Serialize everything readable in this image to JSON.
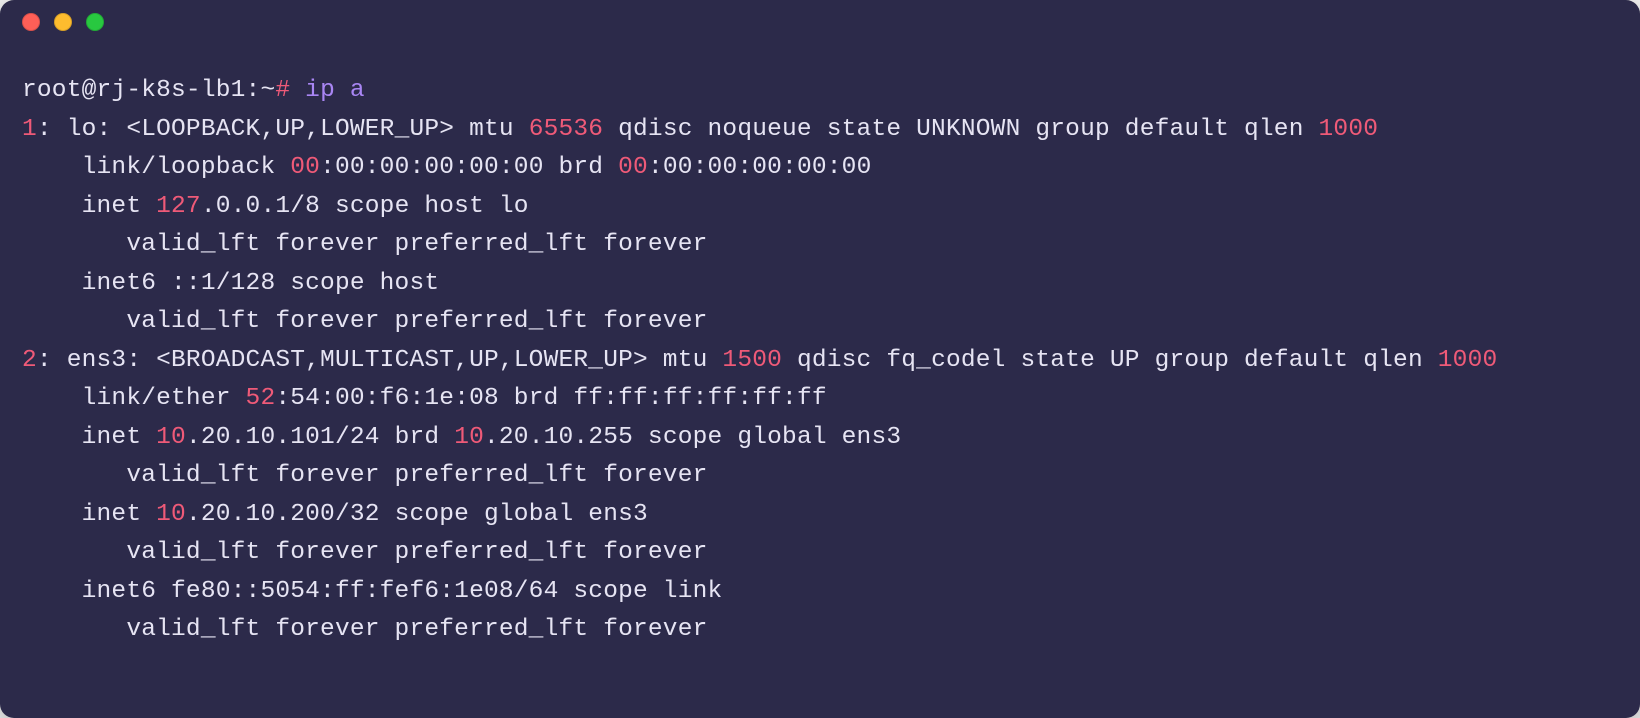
{
  "prompt": {
    "user_host": "root@rj-k8s-lb1",
    "cwd": ":~",
    "hash": "#",
    "command": "ip a"
  },
  "output": [
    {
      "segments": [
        {
          "cls": "fg-rose",
          "text": "1"
        },
        {
          "cls": "fg-default",
          "text": ": lo: <LOOPBACK,UP,LOWER_UP> mtu "
        },
        {
          "cls": "fg-num",
          "text": "65536"
        },
        {
          "cls": "fg-default",
          "text": " qdisc noqueue state UNKNOWN group default qlen "
        },
        {
          "cls": "fg-num",
          "text": "1000"
        }
      ]
    },
    {
      "segments": [
        {
          "cls": "fg-default",
          "text": "    link/loopback "
        },
        {
          "cls": "fg-num",
          "text": "00"
        },
        {
          "cls": "fg-default",
          "text": ":00:00:00:00:00 brd "
        },
        {
          "cls": "fg-num",
          "text": "00"
        },
        {
          "cls": "fg-default",
          "text": ":00:00:00:00:00"
        }
      ]
    },
    {
      "segments": [
        {
          "cls": "fg-default",
          "text": "    inet "
        },
        {
          "cls": "fg-num",
          "text": "127"
        },
        {
          "cls": "fg-default",
          "text": ".0.0.1/8 scope host lo"
        }
      ]
    },
    {
      "segments": [
        {
          "cls": "fg-default",
          "text": "       valid_lft forever preferred_lft forever"
        }
      ]
    },
    {
      "segments": [
        {
          "cls": "fg-default",
          "text": "    inet6 ::1/128 scope host "
        }
      ]
    },
    {
      "segments": [
        {
          "cls": "fg-default",
          "text": "       valid_lft forever preferred_lft forever"
        }
      ]
    },
    {
      "segments": [
        {
          "cls": "fg-rose",
          "text": "2"
        },
        {
          "cls": "fg-default",
          "text": ": ens3: <BROADCAST,MULTICAST,UP,LOWER_UP> mtu "
        },
        {
          "cls": "fg-num",
          "text": "1500"
        },
        {
          "cls": "fg-default",
          "text": " qdisc fq_codel state UP group default qlen "
        },
        {
          "cls": "fg-num",
          "text": "1000"
        }
      ]
    },
    {
      "segments": [
        {
          "cls": "fg-default",
          "text": "    link/ether "
        },
        {
          "cls": "fg-num",
          "text": "52"
        },
        {
          "cls": "fg-default",
          "text": ":54:00:f6:1e:08 brd ff:ff:ff:ff:ff:ff"
        }
      ]
    },
    {
      "segments": [
        {
          "cls": "fg-default",
          "text": "    inet "
        },
        {
          "cls": "fg-num",
          "text": "10"
        },
        {
          "cls": "fg-default",
          "text": ".20.10.101/24 brd "
        },
        {
          "cls": "fg-num",
          "text": "10"
        },
        {
          "cls": "fg-default",
          "text": ".20.10.255 scope global ens3"
        }
      ]
    },
    {
      "segments": [
        {
          "cls": "fg-default",
          "text": "       valid_lft forever preferred_lft forever"
        }
      ]
    },
    {
      "segments": [
        {
          "cls": "fg-default",
          "text": "    inet "
        },
        {
          "cls": "fg-num",
          "text": "10"
        },
        {
          "cls": "fg-default",
          "text": ".20.10.200/32 scope global ens3"
        }
      ]
    },
    {
      "segments": [
        {
          "cls": "fg-default",
          "text": "       valid_lft forever preferred_lft forever"
        }
      ]
    },
    {
      "segments": [
        {
          "cls": "fg-default",
          "text": "    inet6 fe80::5054:ff:fef6:1e08/64 scope link "
        }
      ]
    },
    {
      "segments": [
        {
          "cls": "fg-default",
          "text": "       valid_lft forever preferred_lft forever"
        }
      ]
    }
  ]
}
